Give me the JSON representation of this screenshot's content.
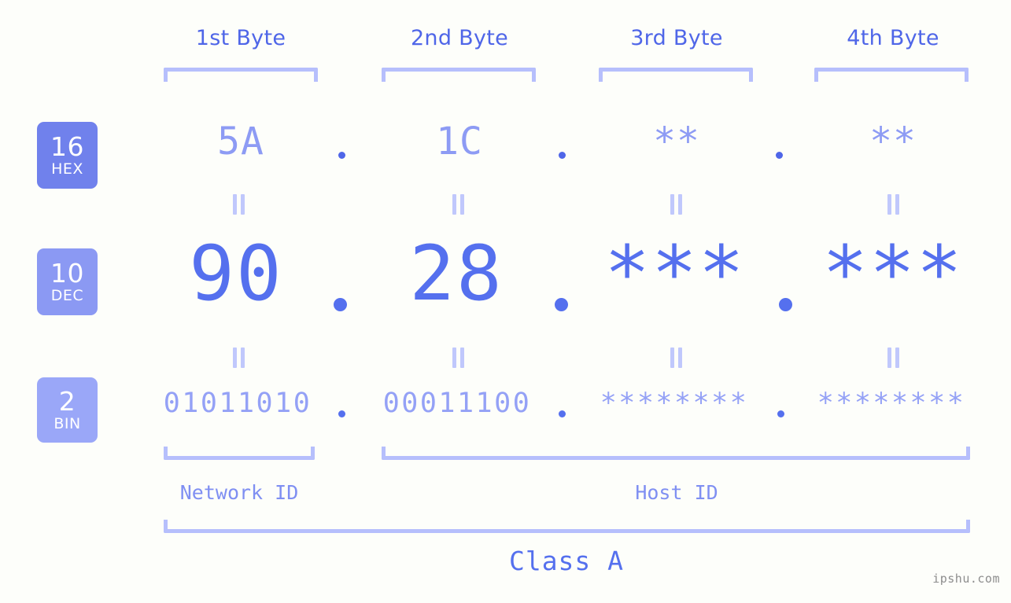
{
  "bytes": [
    {
      "header": "1st Byte"
    },
    {
      "header": "2nd Byte"
    },
    {
      "header": "3rd Byte"
    },
    {
      "header": "4th Byte"
    }
  ],
  "bases": [
    {
      "num": "16",
      "name": "HEX",
      "color": "#7081ec"
    },
    {
      "num": "10",
      "name": "DEC",
      "color": "#8b99f3"
    },
    {
      "num": "2",
      "name": "BIN",
      "color": "#9aa7f8"
    }
  ],
  "rows": {
    "hex": {
      "base": "16",
      "label": "HEX",
      "values": [
        "5A",
        "1C",
        "**",
        "**"
      ],
      "separator": "."
    },
    "dec": {
      "base": "10",
      "label": "DEC",
      "values": [
        "90",
        "28",
        "***",
        "***"
      ],
      "separator": "."
    },
    "bin": {
      "base": "2",
      "label": "BIN",
      "values": [
        "01011010",
        "00011100",
        "********",
        "********"
      ],
      "separator": "."
    }
  },
  "connectors": {
    "symbol": "="
  },
  "regions": {
    "network_id": "Network ID",
    "host_id": "Host ID",
    "class": "Class A"
  },
  "watermark": "ipshu.com",
  "colors": {
    "background": "#fdfefa",
    "bracket": "#b6bffc",
    "header_text": "#4f66e8",
    "hex_text": "#8d9bf4",
    "dec_text": "#5570ee",
    "bin_text": "#94a1f6",
    "dot": "#5570ee",
    "region_text": "#7f8ff2",
    "class_text": "#5570ee",
    "watermark_text": "#8d8d8d"
  }
}
